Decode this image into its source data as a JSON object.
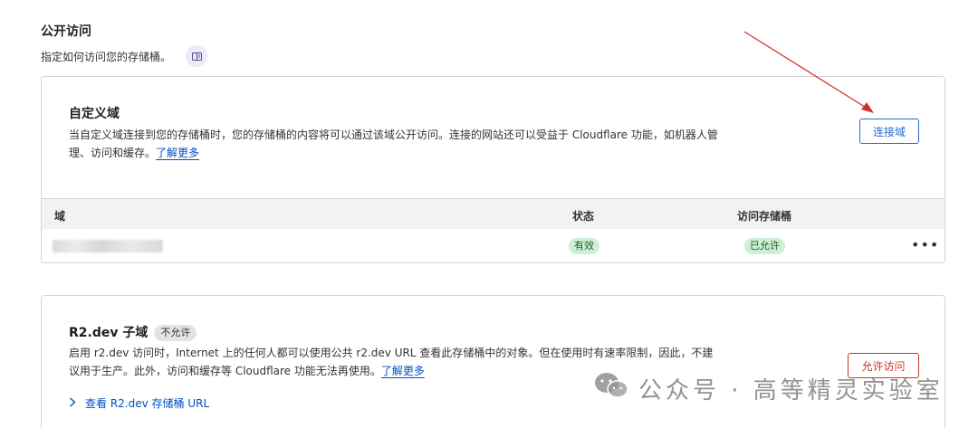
{
  "section": {
    "title": "公开访问",
    "subtitle": "指定如何访问您的存储桶。",
    "doc_icon": "doc-icon"
  },
  "custom_domain": {
    "title": "自定义域",
    "description": "当自定义域连接到您的存储桶时，您的存储桶的内容将可以通过该域公开访问。连接的网站还可以受益于 Cloudflare 功能，如机器人管理、访问和缓存。",
    "learn_more": "了解更多",
    "connect_button": "连接域",
    "table": {
      "columns": [
        "域",
        "状态",
        "访问存储桶"
      ],
      "rows": [
        {
          "domain": "",
          "status": "有效",
          "access": "已允许"
        }
      ],
      "row_menu_icon": "more-horizontal-icon",
      "row_menu_glyph": "•••"
    }
  },
  "r2dev": {
    "title": "R2.dev 子域",
    "badge": "不允许",
    "description": "启用 r2.dev 访问时，Internet 上的任何人都可以使用公共 r2.dev URL 查看此存储桶中的对象。但在使用时有速率限制，因此，不建议用于生产。此外，访问和缓存等 Cloudflare 功能无法再使用。",
    "learn_more": "了解更多",
    "allow_button": "允许访问",
    "expand_label": "查看 R2.dev 存储桶 URL",
    "expand_icon": "chevron-right-icon"
  },
  "watermark": {
    "text": "公众号 · 高等精灵实验室",
    "icon": "wechat-icon"
  },
  "colors": {
    "link": "#0051c3",
    "primary_button": "#2a6ac8",
    "danger_button": "#c9382b",
    "badge_green_bg": "#cfeed6",
    "annotation_arrow": "#d32f2f"
  }
}
